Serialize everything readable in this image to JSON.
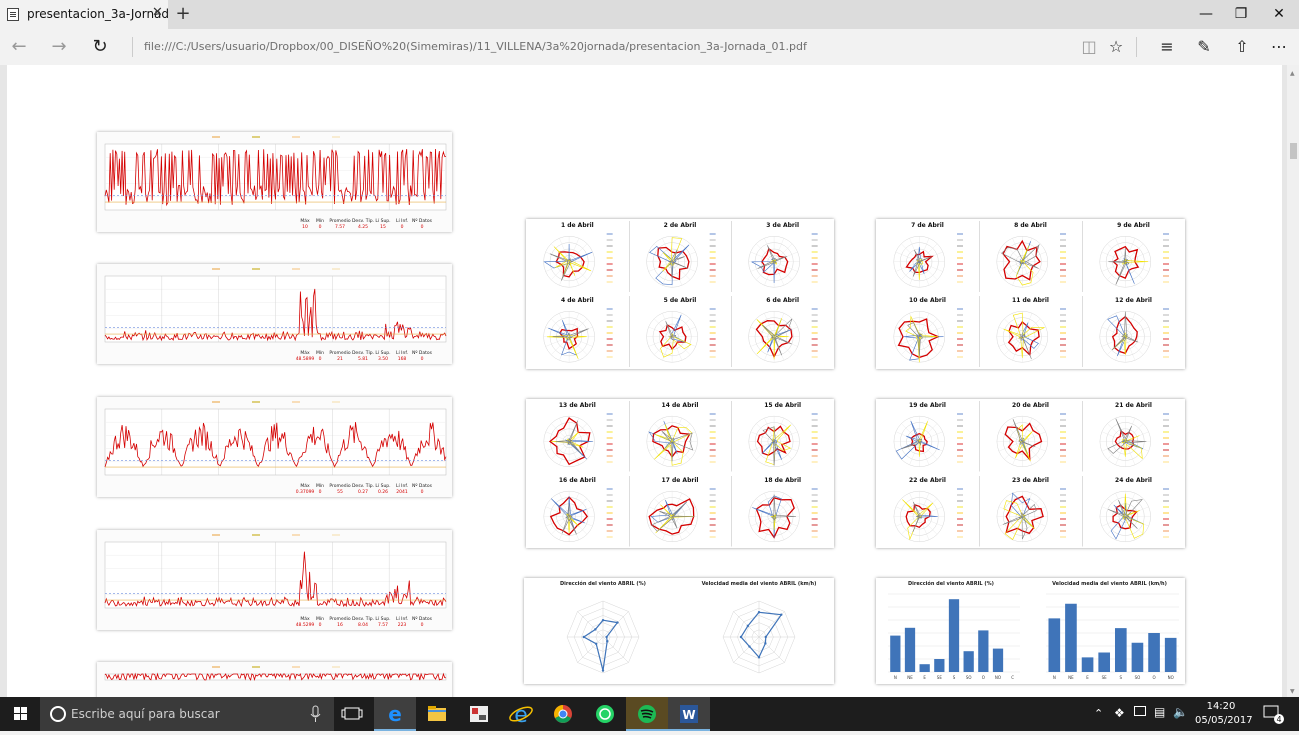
{
  "tab": {
    "title": "presentacion_3a-Jornad",
    "close": "✕",
    "new_tab": "+"
  },
  "window": {
    "minimize": "—",
    "maximize": "❐",
    "close": "✕"
  },
  "address": {
    "url": "file:///C:/Users/usuario/Dropbox/00_DISEÑO%20(Simemiras)/11_VILLENA/3a%20jornada/presentacion_3a-Jornada_01.pdf"
  },
  "timeseries_charts": [
    {
      "stats_labels": [
        "Máx",
        "Mín",
        "Promedio",
        "Desv. Típ.",
        "Lí Sup.",
        "Lí Inf.",
        "Nº Datos"
      ],
      "stats_values": [
        "10",
        "0",
        "7.57",
        "4.25",
        "15",
        "0",
        "0"
      ]
    },
    {
      "stats_labels": [
        "Máx",
        "Mín",
        "Promedio",
        "Desv. Típ.",
        "Lí Sup.",
        "Lí Inf.",
        "Nº Datos"
      ],
      "stats_values": [
        "48.5899",
        "0",
        "21",
        "5.81",
        "3.50",
        "168",
        "0"
      ]
    },
    {
      "stats_labels": [
        "Máx",
        "Mín",
        "Promedio",
        "Desv. Típ.",
        "Lí Sup.",
        "Lí Inf.",
        "Nº Datos"
      ],
      "stats_values": [
        "0.37099",
        "0",
        "55",
        "0.27",
        "0.26",
        "2041",
        "0"
      ]
    },
    {
      "stats_labels": [
        "Máx",
        "Mín",
        "Promedio",
        "Desv. Típ.",
        "Lí Sup.",
        "Lí Inf.",
        "Nº Datos"
      ],
      "stats_values": [
        "48.5299",
        "0",
        "16",
        "8.04",
        "7.57",
        "223",
        "0"
      ]
    },
    {
      "stats_labels": [],
      "stats_values": []
    }
  ],
  "rose_panels": [
    {
      "days": [
        "1 de Abril",
        "2 de Abril",
        "3 de Abril",
        "4 de Abril",
        "5 de Abril",
        "6 de Abril"
      ]
    },
    {
      "days": [
        "7 de Abril",
        "8 de Abril",
        "9 de Abril",
        "10 de Abril",
        "11 de Abril",
        "12 de Abril"
      ]
    },
    {
      "days": [
        "13 de Abril",
        "14 de Abril",
        "15 de Abril",
        "16 de Abril",
        "17 de Abril",
        "18 de Abril"
      ]
    },
    {
      "days": [
        "19 de Abril",
        "20 de Abril",
        "21 de Abril",
        "22 de Abril",
        "23 de Abril",
        "24 de Abril"
      ]
    }
  ],
  "summary_left": {
    "direction_title": "Dirección del viento ABRIL (%)",
    "speed_title": "Velocidad media del viento ABRIL (km/h)"
  },
  "summary_right": {
    "direction_title": "Dirección del viento ABRIL (%)",
    "speed_title": "Velocidad media del viento ABRIL (km/h)"
  },
  "chart_data": [
    {
      "type": "bar",
      "title": "Dirección del viento ABRIL (%)",
      "categories": [
        "N",
        "NE",
        "E",
        "SE",
        "S",
        "SO",
        "O",
        "NO",
        "C"
      ],
      "values": [
        14,
        17,
        3,
        5,
        28,
        8,
        16,
        9,
        0
      ],
      "ylim": [
        0,
        30
      ]
    },
    {
      "type": "bar",
      "title": "Velocidad media del viento ABRIL (km/h)",
      "categories": [
        "N",
        "NE",
        "E",
        "SE",
        "S",
        "SO",
        "O",
        "NO"
      ],
      "values": [
        11,
        14,
        3,
        4,
        9,
        6,
        8,
        7
      ],
      "ylim": [
        0,
        16
      ]
    }
  ],
  "colors": {
    "series_red": "#d40000",
    "bar_blue": "#3f74b9",
    "rose_blue": "#4472c4",
    "accent": "#0078d7"
  },
  "taskbar": {
    "search_placeholder": "Escribe aquí para buscar",
    "time": "14:20",
    "date": "05/05/2017",
    "notifications": "4",
    "apps": [
      "task-view",
      "edge",
      "file-explorer",
      "photos",
      "internet-explorer",
      "chrome",
      "whatsapp",
      "spotify",
      "word"
    ]
  }
}
